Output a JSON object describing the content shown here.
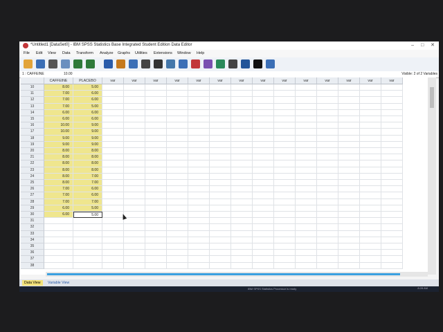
{
  "window": {
    "title": "*Untitled1 [DataSet0] - IBM SPSS Statistics Base Integrated Student Edition Data Editor"
  },
  "menu": [
    "File",
    "Edit",
    "View",
    "Data",
    "Transform",
    "Analyze",
    "Graphs",
    "Utilities",
    "Extensions",
    "Window",
    "Help"
  ],
  "toolbar": [
    "open-icon",
    "save-icon",
    "print-icon",
    "recall-dialog-icon",
    "undo-icon",
    "redo-icon",
    "goto-case-icon",
    "goto-variable-icon",
    "variables-icon",
    "run-icon",
    "find-icon",
    "insert-cases-icon",
    "insert-variable-icon",
    "split-file-icon",
    "weight-cases-icon",
    "select-cases-icon",
    "value-labels-icon",
    "use-sets-icon",
    "show-all-icon",
    "spell-icon"
  ],
  "cellbar": {
    "ref": "1 : CAFFEINE",
    "value": "10.00",
    "visible": "Visible: 2 of 2 Variables"
  },
  "columns": {
    "caffeine": "CAFFEINE",
    "placebo": "PLACEBO",
    "var": "var"
  },
  "rows": [
    {
      "n": "10",
      "caffeine": "8.00",
      "placebo": "5.00"
    },
    {
      "n": "11",
      "caffeine": "7.00",
      "placebo": "6.00"
    },
    {
      "n": "12",
      "caffeine": "7.00",
      "placebo": "6.00"
    },
    {
      "n": "13",
      "caffeine": "7.00",
      "placebo": "5.00"
    },
    {
      "n": "14",
      "caffeine": "6.00",
      "placebo": "6.00"
    },
    {
      "n": "15",
      "caffeine": "6.00",
      "placebo": "6.00"
    },
    {
      "n": "16",
      "caffeine": "10.00",
      "placebo": "9.00"
    },
    {
      "n": "17",
      "caffeine": "10.00",
      "placebo": "9.00"
    },
    {
      "n": "18",
      "caffeine": "9.00",
      "placebo": "9.00"
    },
    {
      "n": "19",
      "caffeine": "9.00",
      "placebo": "9.00"
    },
    {
      "n": "20",
      "caffeine": "8.00",
      "placebo": "8.00"
    },
    {
      "n": "21",
      "caffeine": "8.00",
      "placebo": "8.00"
    },
    {
      "n": "22",
      "caffeine": "8.00",
      "placebo": "8.00"
    },
    {
      "n": "23",
      "caffeine": "8.00",
      "placebo": "8.00"
    },
    {
      "n": "24",
      "caffeine": "8.00",
      "placebo": "7.00"
    },
    {
      "n": "25",
      "caffeine": "8.00",
      "placebo": "7.00"
    },
    {
      "n": "26",
      "caffeine": "7.00",
      "placebo": "6.00"
    },
    {
      "n": "27",
      "caffeine": "7.00",
      "placebo": "6.00"
    },
    {
      "n": "28",
      "caffeine": "7.00",
      "placebo": "7.00"
    },
    {
      "n": "29",
      "caffeine": "6.00",
      "placebo": "5.00"
    },
    {
      "n": "30",
      "caffeine": "6.00",
      "placebo": "5.00"
    },
    {
      "n": "31",
      "caffeine": "",
      "placebo": ""
    },
    {
      "n": "32",
      "caffeine": "",
      "placebo": ""
    },
    {
      "n": "33",
      "caffeine": "",
      "placebo": ""
    },
    {
      "n": "34",
      "caffeine": "",
      "placebo": ""
    },
    {
      "n": "35",
      "caffeine": "",
      "placebo": ""
    },
    {
      "n": "36",
      "caffeine": "",
      "placebo": ""
    },
    {
      "n": "37",
      "caffeine": "",
      "placebo": ""
    },
    {
      "n": "38",
      "caffeine": "",
      "placebo": ""
    }
  ],
  "selected_row": "30",
  "tabs": {
    "data_view": "Data View",
    "variable_view": "Variable View"
  },
  "statusbar": {
    "status": "IBM SPSS Statistics Processor is ready",
    "time": "8:28 AM"
  },
  "colors": {
    "accent_yellow": "#efe68e",
    "scroll_blue": "#3aa0e0",
    "icon_red": "#c2373a"
  }
}
